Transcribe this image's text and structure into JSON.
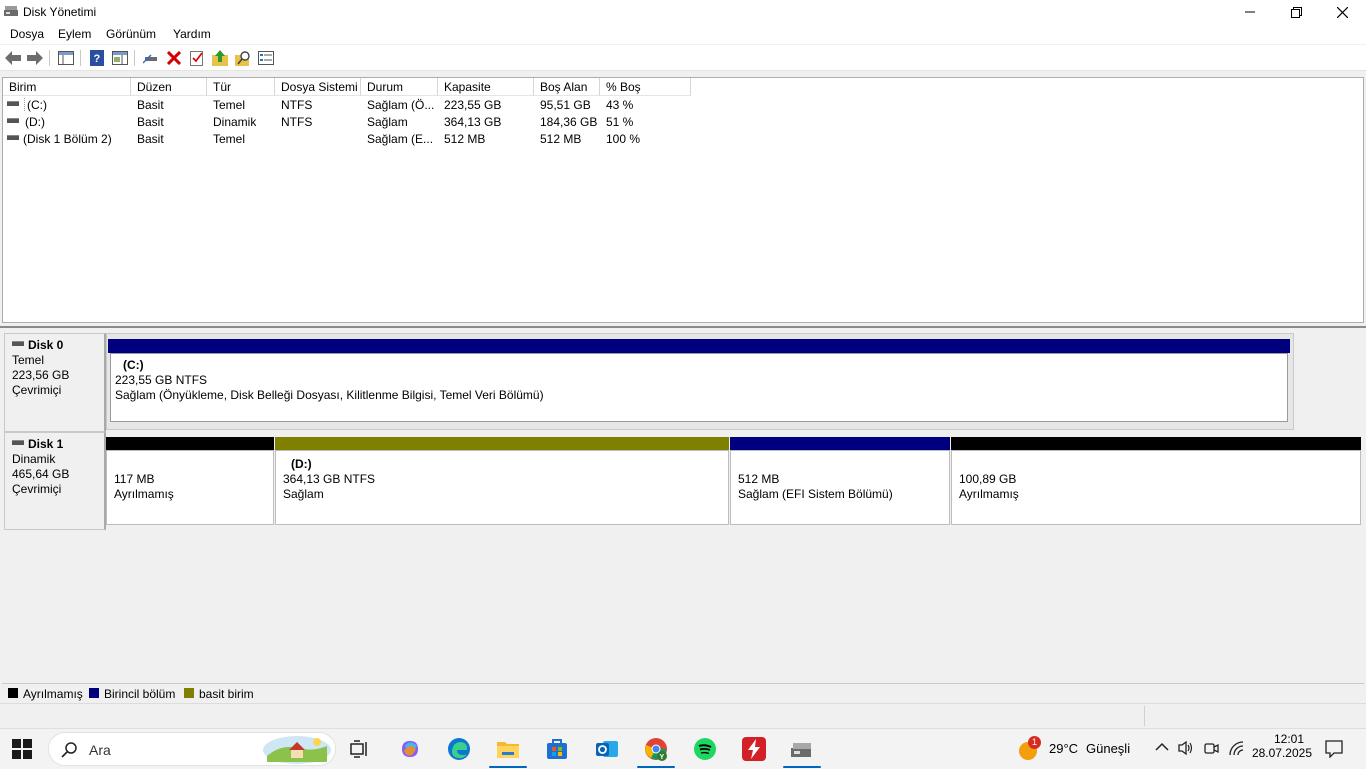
{
  "window": {
    "title": "Disk Yönetimi"
  },
  "menu": [
    "Dosya",
    "Eylem",
    "Görünüm",
    "Yardım"
  ],
  "volume_table": {
    "columns": [
      "Birim",
      "Düzen",
      "Tür",
      "Dosya Sistemi",
      "Durum",
      "Kapasite",
      "Boş Alan",
      "% Boş"
    ],
    "rows": [
      [
        "(C:)",
        "Basit",
        "Temel",
        "NTFS",
        "Sağlam (Ö...",
        "223,55 GB",
        "95,51 GB",
        "43 %"
      ],
      [
        "(D:)",
        "Basit",
        "Dinamik",
        "NTFS",
        "Sağlam",
        "364,13 GB",
        "184,36 GB",
        "51 %"
      ],
      [
        "(Disk 1 Bölüm 2)",
        "Basit",
        "Temel",
        "",
        "Sağlam (E...",
        "512 MB",
        "512 MB",
        "100 %"
      ]
    ]
  },
  "disks": [
    {
      "name": "Disk 0",
      "type": "Temel",
      "size": "223,56 GB",
      "status": "Çevrimiçi",
      "partitions": [
        {
          "title": "(C:)",
          "line1": "223,55 GB NTFS",
          "line2": "Sağlam (Önyükleme, Disk Belleği Dosyası, Kilitlenme Bilgisi, Temel Veri Bölümü)",
          "kind": "primary"
        }
      ]
    },
    {
      "name": "Disk 1",
      "type": "Dinamik",
      "size": "465,64 GB",
      "status": "Çevrimiçi",
      "partitions": [
        {
          "title": "",
          "line1": "117 MB",
          "line2": "Ayrılmamış",
          "kind": "unallocated"
        },
        {
          "title": "(D:)",
          "line1": "364,13 GB NTFS",
          "line2": "Sağlam",
          "kind": "simple"
        },
        {
          "title": "",
          "line1": "512 MB",
          "line2": "Sağlam (EFI Sistem Bölümü)",
          "kind": "primary"
        },
        {
          "title": "",
          "line1": "100,89 GB",
          "line2": "Ayrılmamış",
          "kind": "unallocated"
        }
      ]
    }
  ],
  "legend": [
    {
      "label": "Ayrılmamış",
      "color": "#000000"
    },
    {
      "label": "Birincil bölüm",
      "color": "#00007f"
    },
    {
      "label": "basit birim",
      "color": "#808000"
    }
  ],
  "taskbar": {
    "search_placeholder": "Ara",
    "weather_temp": "29°C",
    "weather_text": "Güneşli",
    "weather_badge": "1",
    "time": "12:01",
    "date": "28.07.2025"
  }
}
